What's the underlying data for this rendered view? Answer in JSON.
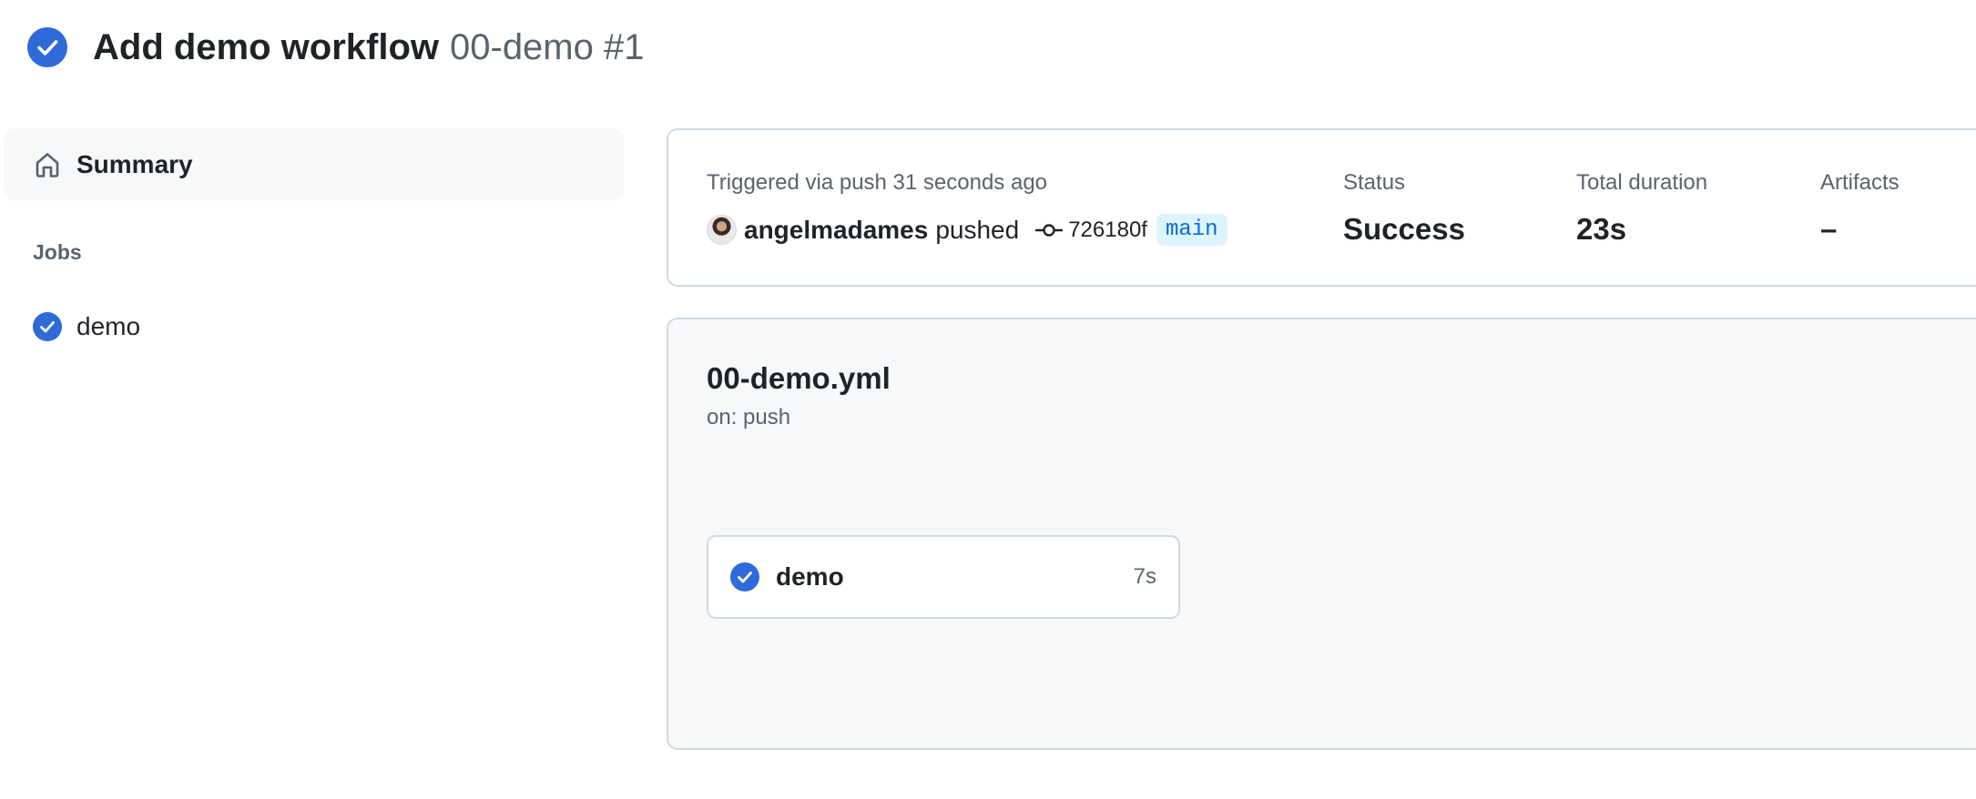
{
  "header": {
    "title": "Add demo workflow",
    "subtitle": "00-demo #1",
    "status_icon": "check-circle-fill-icon"
  },
  "sidebar": {
    "summary_label": "Summary",
    "summary_icon": "home-icon",
    "jobs_heading": "Jobs",
    "jobs": [
      {
        "label": "demo",
        "status": "success"
      }
    ]
  },
  "run_info": {
    "trigger_text": "Triggered via push 31 seconds ago",
    "pusher": "angelmadames",
    "pushed_word": "pushed",
    "commit_sha": "726180f",
    "branch": "main",
    "status_label": "Status",
    "status_value": "Success",
    "duration_label": "Total duration",
    "duration_value": "23s",
    "artifacts_label": "Artifacts",
    "artifacts_value": "–"
  },
  "workflow": {
    "file_name": "00-demo.yml",
    "trigger": "on: push",
    "jobs": [
      {
        "name": "demo",
        "duration": "7s",
        "status": "success"
      }
    ]
  },
  "colors": {
    "success_blue": "#2f6ad9",
    "muted_text": "#59636e",
    "border": "#d1d9e0",
    "panel_bg": "#f6f8fa",
    "branch_bg": "#ddf4ff",
    "branch_fg": "#0969da"
  }
}
